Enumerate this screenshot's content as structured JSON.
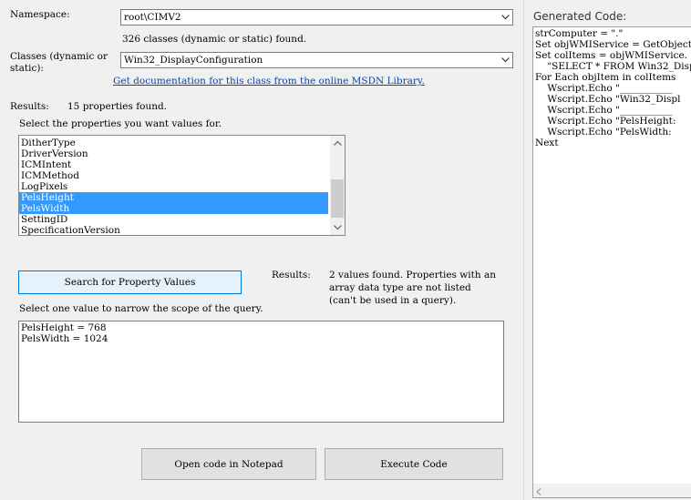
{
  "namespace": {
    "label": "Namespace:",
    "value": "root\\CIMV2"
  },
  "classes_found": "326 classes (dynamic or static) found.",
  "classes": {
    "label_line1": "Classes (dynamic or",
    "label_line2": "static):",
    "value": "Win32_DisplayConfiguration"
  },
  "doc_link": "Get documentation for this class from the online MSDN Library.",
  "results": {
    "label": "Results:",
    "text": "15 properties found."
  },
  "select_props_label": "Select the properties you want values for.",
  "properties": [
    {
      "label": "DitherType",
      "selected": false
    },
    {
      "label": "DriverVersion",
      "selected": false
    },
    {
      "label": "ICMIntent",
      "selected": false
    },
    {
      "label": "ICMMethod",
      "selected": false
    },
    {
      "label": "LogPixels",
      "selected": false
    },
    {
      "label": "PelsHeight",
      "selected": true
    },
    {
      "label": "PelsWidth",
      "selected": true
    },
    {
      "label": "SettingID",
      "selected": false
    },
    {
      "label": "SpecificationVersion",
      "selected": false
    }
  ],
  "search_button": "Search for Property Values",
  "results2": {
    "label": "Results:",
    "line1": "2 values found. Properties with an",
    "line2": "array data type are not listed",
    "line3": "(can't be used in a query)."
  },
  "narrow_label": "Select one value to narrow the scope of the query.",
  "values": [
    "PelsHeight = 768",
    "PelsWidth = 1024"
  ],
  "open_notepad_button": "Open code in Notepad",
  "execute_button": "Execute Code",
  "generated_code_title": "Generated Code:",
  "code_lines": [
    "strComputer = \".\"",
    "Set objWMIService = GetObject(",
    "Set colItems = objWMIService.",
    "    \"SELECT * FROM Win32_Disp",
    "For Each objItem in colItems",
    "    Wscript.Echo \"___________",
    "    Wscript.Echo \"Win32_Displ",
    "    Wscript.Echo \"___________",
    "    Wscript.Echo \"PelsHeight:",
    "    Wscript.Echo \"PelsWidth: ",
    "Next"
  ]
}
